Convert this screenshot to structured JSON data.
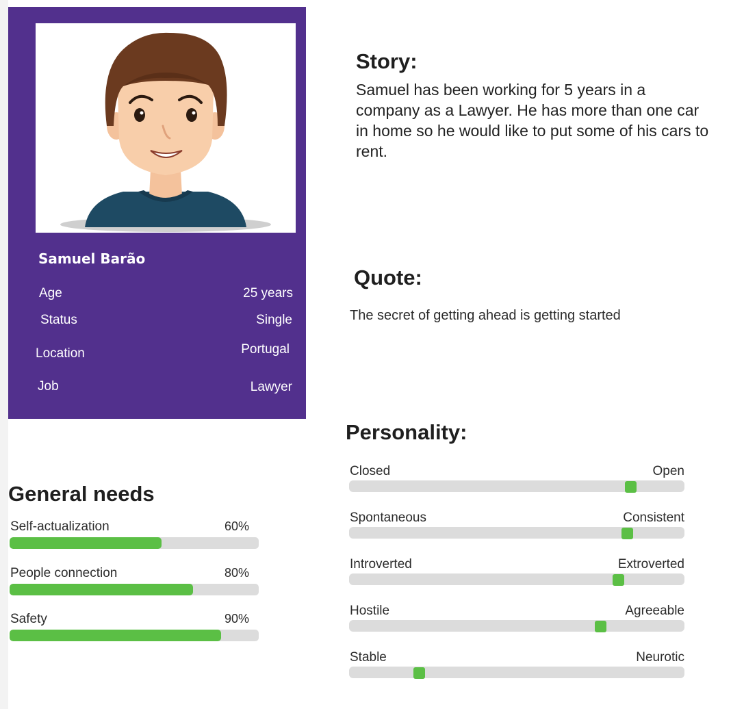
{
  "profile": {
    "name": "Samuel Barão",
    "attributes": [
      {
        "label": "Age",
        "value": "25 years"
      },
      {
        "label": "Status",
        "value": "Single"
      },
      {
        "label": "Location",
        "value": "Portugal"
      },
      {
        "label": "Job",
        "value": "Lawyer"
      }
    ],
    "photo_icon": "avatar-illustration",
    "card_color": "#52308d"
  },
  "story": {
    "heading": "Story:",
    "text": "Samuel has been working for 5 years in a company as a Lawyer. He has more than one car in home so he would like to put some of his cars to rent."
  },
  "quote": {
    "heading": "Quote:",
    "text": "The secret of getting ahead is getting started"
  },
  "general_needs": {
    "heading": "General needs",
    "items": [
      {
        "label": "Self-actualization",
        "percent_label": "60%",
        "level": 0.61
      },
      {
        "label": "People connection",
        "percent_label": "80%",
        "level": 0.735
      },
      {
        "label": "Safety",
        "percent_label": "90%",
        "level": 0.85
      }
    ],
    "fill_color": "#5bbf45"
  },
  "personality": {
    "heading": "Personality:",
    "traits": [
      {
        "left": "Closed",
        "right": "Open",
        "level": 0.84
      },
      {
        "left": "Spontaneous",
        "right": "Consistent",
        "level": 0.83
      },
      {
        "left": "Introverted",
        "right": "Extroverted",
        "level": 0.805
      },
      {
        "left": "Hostile",
        "right": "Agreeable",
        "level": 0.75
      },
      {
        "left": "Stable",
        "right": "Neurotic",
        "level": 0.21
      }
    ],
    "knob_color": "#5bbf45"
  }
}
